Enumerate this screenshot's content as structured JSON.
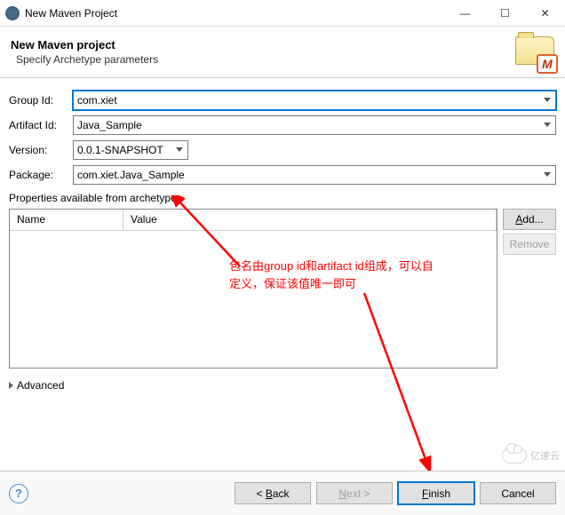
{
  "titlebar": {
    "title": "New Maven Project"
  },
  "banner": {
    "title": "New Maven project",
    "subtitle": "Specify Archetype parameters",
    "icon_badge": "M"
  },
  "form": {
    "group_id": {
      "label": "Group Id:",
      "value": "com.xiet"
    },
    "artifact_id": {
      "label": "Artifact Id:",
      "value": "Java_Sample"
    },
    "version": {
      "label": "Version:",
      "value": "0.0.1-SNAPSHOT"
    },
    "package": {
      "label": "Package:",
      "value": "com.xiet.Java_Sample"
    }
  },
  "properties": {
    "heading": "Properties available from archetype:",
    "columns": {
      "name": "Name",
      "value": "Value"
    },
    "rows": [],
    "buttons": {
      "add": "Add...",
      "remove": "Remove"
    }
  },
  "advanced": {
    "label": "Advanced"
  },
  "footer": {
    "back": "< Back",
    "next": "Next >",
    "finish": "Finish",
    "cancel": "Cancel"
  },
  "annotation": {
    "line1": "包名由group id和artifact id组成，可以自",
    "line2": "定义，保证该值唯一即可"
  },
  "watermark": "亿速云"
}
